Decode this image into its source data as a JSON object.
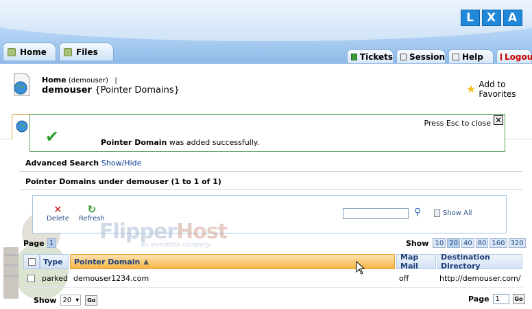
{
  "logo": {
    "letters": [
      "L",
      "X",
      "A"
    ]
  },
  "top_tabs": [
    {
      "label": "Home",
      "icon": "home-tab-icon"
    },
    {
      "label": "Files",
      "icon": "files-tab-icon"
    }
  ],
  "right_tabs": [
    {
      "label": "Tickets"
    },
    {
      "label": "Session"
    },
    {
      "label": "Help"
    },
    {
      "label": "Logout",
      "color": "#cc0000"
    }
  ],
  "breadcrumb": {
    "home": "Home",
    "user": "(demouser)",
    "sep": "|"
  },
  "title": {
    "user": "demouser",
    "suffix": "{Pointer Domains}"
  },
  "favorites": {
    "label": "Add to Favorites"
  },
  "toast": {
    "esc_text": "Press Esc to close",
    "close": "✕",
    "bold": "Pointer Domain",
    "rest": " was added successfully."
  },
  "advanced_search": {
    "label": "Advanced Search",
    "link": "Show/Hide"
  },
  "list_heading": "Pointer Domains under demouser (1 to 1 of 1)",
  "toolbar": {
    "delete": "Delete",
    "refresh": "Refresh",
    "search_value": "",
    "show_all": "Show All"
  },
  "watermark": {
    "brand": "Flipper",
    "brand2": "Host",
    "tagline": "an investlion company"
  },
  "paging": {
    "label": "Page",
    "current": "1",
    "show_label": "Show",
    "sizes": [
      "10",
      "20",
      "40",
      "80",
      "160",
      "320"
    ],
    "selected_size": "20"
  },
  "table": {
    "headers": {
      "type": "Type",
      "pointer_domain": "Pointer Domain",
      "map_mail": "Map Mail",
      "destination": "Destination Directory"
    },
    "sort_indicator": "▲",
    "rows": [
      {
        "type": "parked",
        "pointer_domain": "demouser1234.com",
        "map_mail": "off",
        "destination": "http://demouser.com/"
      }
    ]
  },
  "footer": {
    "show_label": "Show",
    "show_value": "20",
    "go": "Go",
    "page_label": "Page",
    "page_value": "1",
    "go2": "Go"
  },
  "colors": {
    "accent_orange": "#f7b547",
    "header_blue": "#8ebbe9",
    "success_green": "#2ea02e",
    "logout_red": "#cc0000"
  }
}
